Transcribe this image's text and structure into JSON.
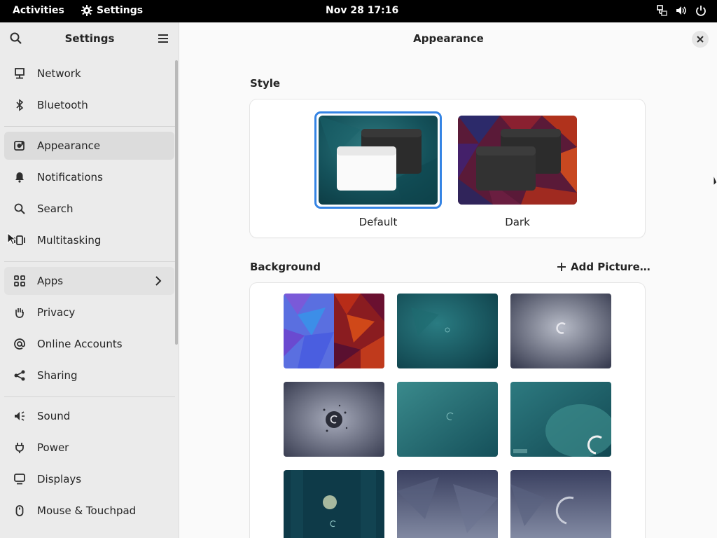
{
  "topbar": {
    "activities": "Activities",
    "app_name": "Settings",
    "clock": "Nov 28  17:16"
  },
  "sidebar": {
    "title": "Settings",
    "items": [
      {
        "label": "Network",
        "icon": "network-icon"
      },
      {
        "label": "Bluetooth",
        "icon": "bluetooth-icon"
      },
      {
        "label": "Appearance",
        "icon": "appearance-icon",
        "active": true
      },
      {
        "label": "Notifications",
        "icon": "bell-icon"
      },
      {
        "label": "Search",
        "icon": "search-icon"
      },
      {
        "label": "Multitasking",
        "icon": "multitasking-icon"
      },
      {
        "label": "Apps",
        "icon": "apps-grid-icon"
      },
      {
        "label": "Privacy",
        "icon": "hand-icon"
      },
      {
        "label": "Online Accounts",
        "icon": "at-icon"
      },
      {
        "label": "Sharing",
        "icon": "share-icon"
      },
      {
        "label": "Sound",
        "icon": "speaker-icon"
      },
      {
        "label": "Power",
        "icon": "power-plug-icon"
      },
      {
        "label": "Displays",
        "icon": "display-icon"
      },
      {
        "label": "Mouse & Touchpad",
        "icon": "mouse-icon"
      }
    ]
  },
  "main": {
    "title": "Appearance",
    "style_section": "Style",
    "style_options": [
      {
        "label": "Default",
        "selected": true
      },
      {
        "label": "Dark",
        "selected": false
      }
    ],
    "background_section": "Background",
    "add_picture": "Add Picture…"
  },
  "colors": {
    "accent": "#3584e4",
    "sidebar_bg": "#ebebeb",
    "topbar_bg": "#000000"
  }
}
